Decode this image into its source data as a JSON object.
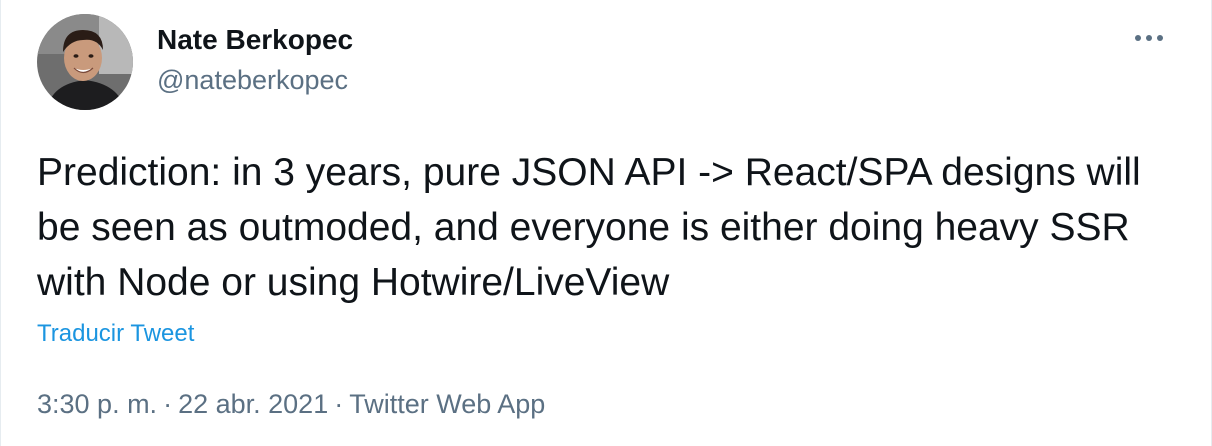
{
  "author": {
    "display_name": "Nate Berkopec",
    "handle": "@nateberkopec"
  },
  "tweet": {
    "text": "Prediction: in 3 years, pure JSON API -> React/SPA designs will be seen as outmoded, and everyone is either doing heavy SSR with Node or using Hotwire/LiveView",
    "translate_label": "Traducir Tweet"
  },
  "meta": {
    "time": "3:30 p. m.",
    "separator": "·",
    "date": "22 abr. 2021",
    "source": "Twitter Web App"
  },
  "icons": {
    "avatar": "profile-photo",
    "more": "more-horizontal-icon"
  },
  "colors": {
    "text": "#0f1419",
    "secondary": "#5b7083",
    "link": "#1b95e0"
  }
}
